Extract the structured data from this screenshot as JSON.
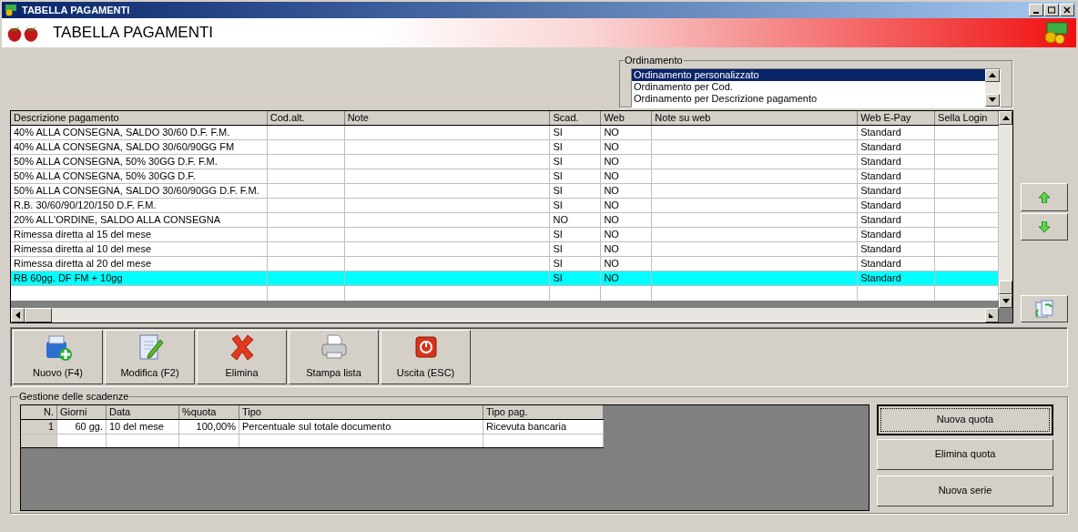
{
  "window": {
    "title": "TABELLA PAGAMENTI"
  },
  "header": {
    "title": "TABELLA PAGAMENTI"
  },
  "ordinamento": {
    "label": "Ordinamento",
    "options": [
      {
        "label": "Ordinamento personalizzato",
        "selected": true
      },
      {
        "label": "Ordinamento per Cod.",
        "selected": false
      },
      {
        "label": "Ordinamento per Descrizione pagamento",
        "selected": false
      }
    ]
  },
  "table": {
    "columns": [
      "Descrizione pagamento",
      "Cod.alt.",
      "Note",
      "Scad.",
      "Web",
      "Note su web",
      "Web E-Pay",
      "Sella Login"
    ],
    "rows": [
      {
        "description": "40% ALLA CONSEGNA, SALDO 30/60 D.F. F.M.",
        "scad": "SI",
        "web": "NO",
        "web_epay": "Standard",
        "selected": false
      },
      {
        "description": "40% ALLA CONSEGNA, SALDO 30/60/90GG FM",
        "scad": "SI",
        "web": "NO",
        "web_epay": "Standard",
        "selected": false
      },
      {
        "description": "50% ALLA CONSEGNA, 50% 30GG D.F. F.M.",
        "scad": "SI",
        "web": "NO",
        "web_epay": "Standard",
        "selected": false
      },
      {
        "description": "50% ALLA CONSEGNA, 50% 30GG D.F.",
        "scad": "SI",
        "web": "NO",
        "web_epay": "Standard",
        "selected": false
      },
      {
        "description": "50% ALLA CONSEGNA, SALDO 30/60/90GG D.F. F.M.",
        "scad": "SI",
        "web": "NO",
        "web_epay": "Standard",
        "selected": false
      },
      {
        "description": "R.B. 30/60/90/120/150 D.F. F.M.",
        "scad": "SI",
        "web": "NO",
        "web_epay": "Standard",
        "selected": false
      },
      {
        "description": "20% ALL'ORDINE, SALDO ALLA CONSEGNA",
        "scad": "NO",
        "web": "NO",
        "web_epay": "Standard",
        "selected": false
      },
      {
        "description": "Rimessa diretta al 15 del mese",
        "scad": "SI",
        "web": "NO",
        "web_epay": "Standard",
        "selected": false
      },
      {
        "description": "Rimessa diretta al 10 del mese",
        "scad": "SI",
        "web": "NO",
        "web_epay": "Standard",
        "selected": false
      },
      {
        "description": "Rimessa diretta al 20 del mese",
        "scad": "SI",
        "web": "NO",
        "web_epay": "Standard",
        "selected": false
      },
      {
        "description": "RB 60gg. DF FM + 10gg",
        "scad": "SI",
        "web": "NO",
        "web_epay": "Standard",
        "selected": true
      }
    ]
  },
  "toolbar": [
    {
      "label": "Nuovo (F4)",
      "kind": "new"
    },
    {
      "label": "Modifica (F2)",
      "kind": "edit"
    },
    {
      "label": "Elimina",
      "kind": "delete"
    },
    {
      "label": "Stampa lista",
      "kind": "print"
    },
    {
      "label": "Uscita (ESC)",
      "kind": "exit"
    }
  ],
  "scadenze": {
    "label": "Gestione delle scadenze",
    "columns": [
      "N.",
      "Giorni",
      "Data",
      "%quota",
      "Tipo",
      "Tipo pag."
    ],
    "rows": [
      {
        "n": "1",
        "giorni": "60 gg.",
        "data": "10 del mese",
        "quota": "100,00%",
        "tipo": "Percentuale sul totale documento",
        "tipo_pag": "Ricevuta bancaria"
      }
    ],
    "buttons": [
      {
        "label": "Nuova quota",
        "focused": true
      },
      {
        "label": "Elimina quota",
        "focused": false
      },
      {
        "label": "Nuova serie",
        "focused": false
      }
    ]
  }
}
